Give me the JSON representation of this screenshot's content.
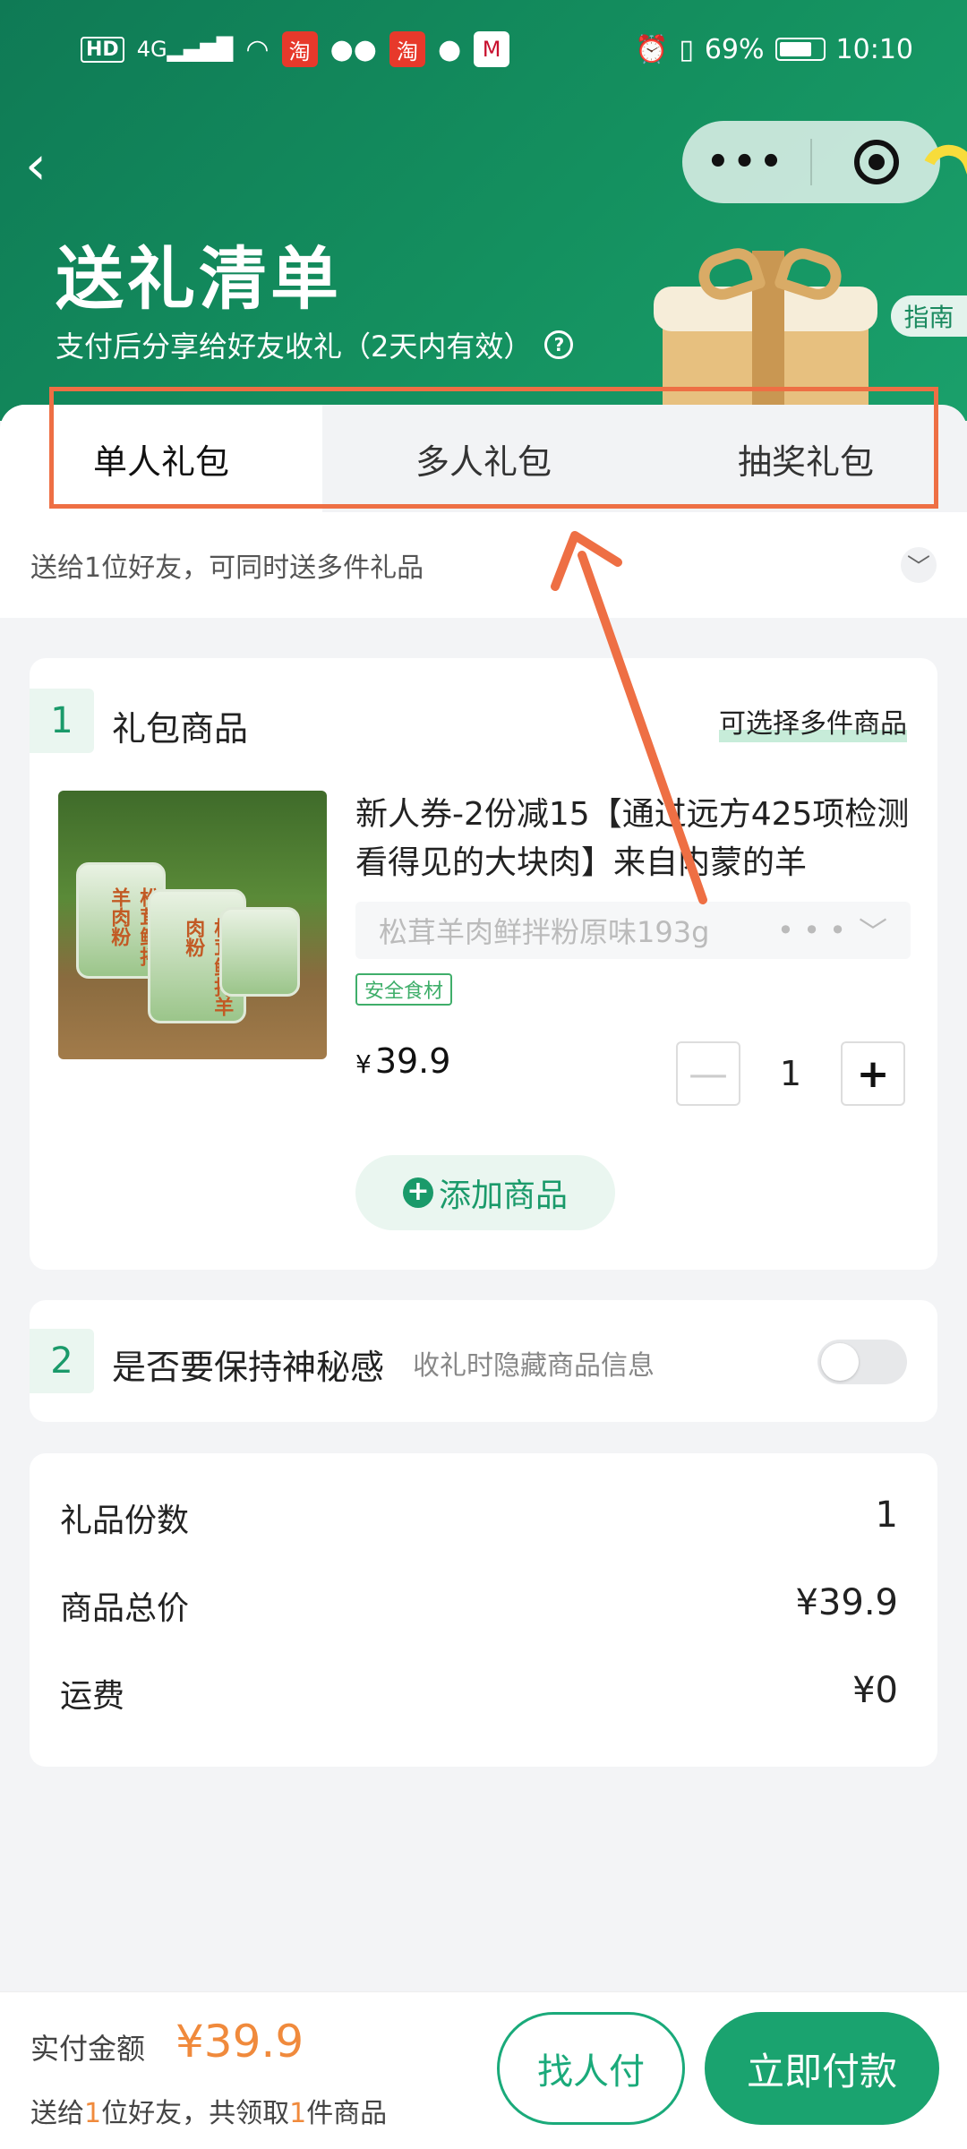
{
  "status_bar": {
    "network": "HD",
    "signal": "4G",
    "apps": [
      "淘",
      "淘"
    ],
    "battery": "69%",
    "time": "10:10"
  },
  "header": {
    "title": "送礼清单",
    "subtitle": "支付后分享给好友收礼（2天内有效）",
    "help_icon": "?",
    "guide_tag": "指南",
    "capsule_more": "•••"
  },
  "tabs": [
    {
      "label": "单人礼包",
      "active": true
    },
    {
      "label": "多人礼包",
      "active": false
    },
    {
      "label": "抽奖礼包",
      "active": false
    }
  ],
  "hint": {
    "text": "送给1位好友，可同时送多件礼品",
    "chevron": "﹀"
  },
  "gift_items": {
    "step": "1",
    "title": "礼包商品",
    "multi_tag": "可选择多件商品",
    "product": {
      "title": "新人券-2份减15【通过远方425项检测 看得见的大块肉】来自内蒙的羊",
      "spec": "松茸羊肉鲜拌粉原味193g",
      "spec_more": "• • •",
      "safe_tag": "安全食材",
      "currency": "¥",
      "price": "39.9",
      "quantity": "1",
      "minus": "—",
      "plus": "+",
      "image_label": "松茸鲜拌羊肉粉"
    },
    "add_label": "添加商品",
    "add_icon": "+"
  },
  "secret": {
    "step": "2",
    "title": "是否要保持神秘感",
    "desc": "收礼时隐藏商品信息",
    "enabled": false
  },
  "summary": {
    "rows": [
      {
        "label": "礼品份数",
        "value": "1"
      },
      {
        "label": "商品总价",
        "value": "¥39.9"
      },
      {
        "label": "运费",
        "value": "¥0"
      }
    ]
  },
  "footer": {
    "pay_label": "实付金额",
    "pay_amount": "¥39.9",
    "note_pre": "送给",
    "note_friends": "1",
    "note_mid": "位好友，共领取",
    "note_items": "1",
    "note_post": "件商品",
    "friend_pay": "找人付",
    "pay_now": "立即付款"
  },
  "colors": {
    "header_green": "#14905f",
    "accent_green": "#1aa36f",
    "price_orange": "#f08a3c",
    "annotation": "#ee6f44"
  }
}
